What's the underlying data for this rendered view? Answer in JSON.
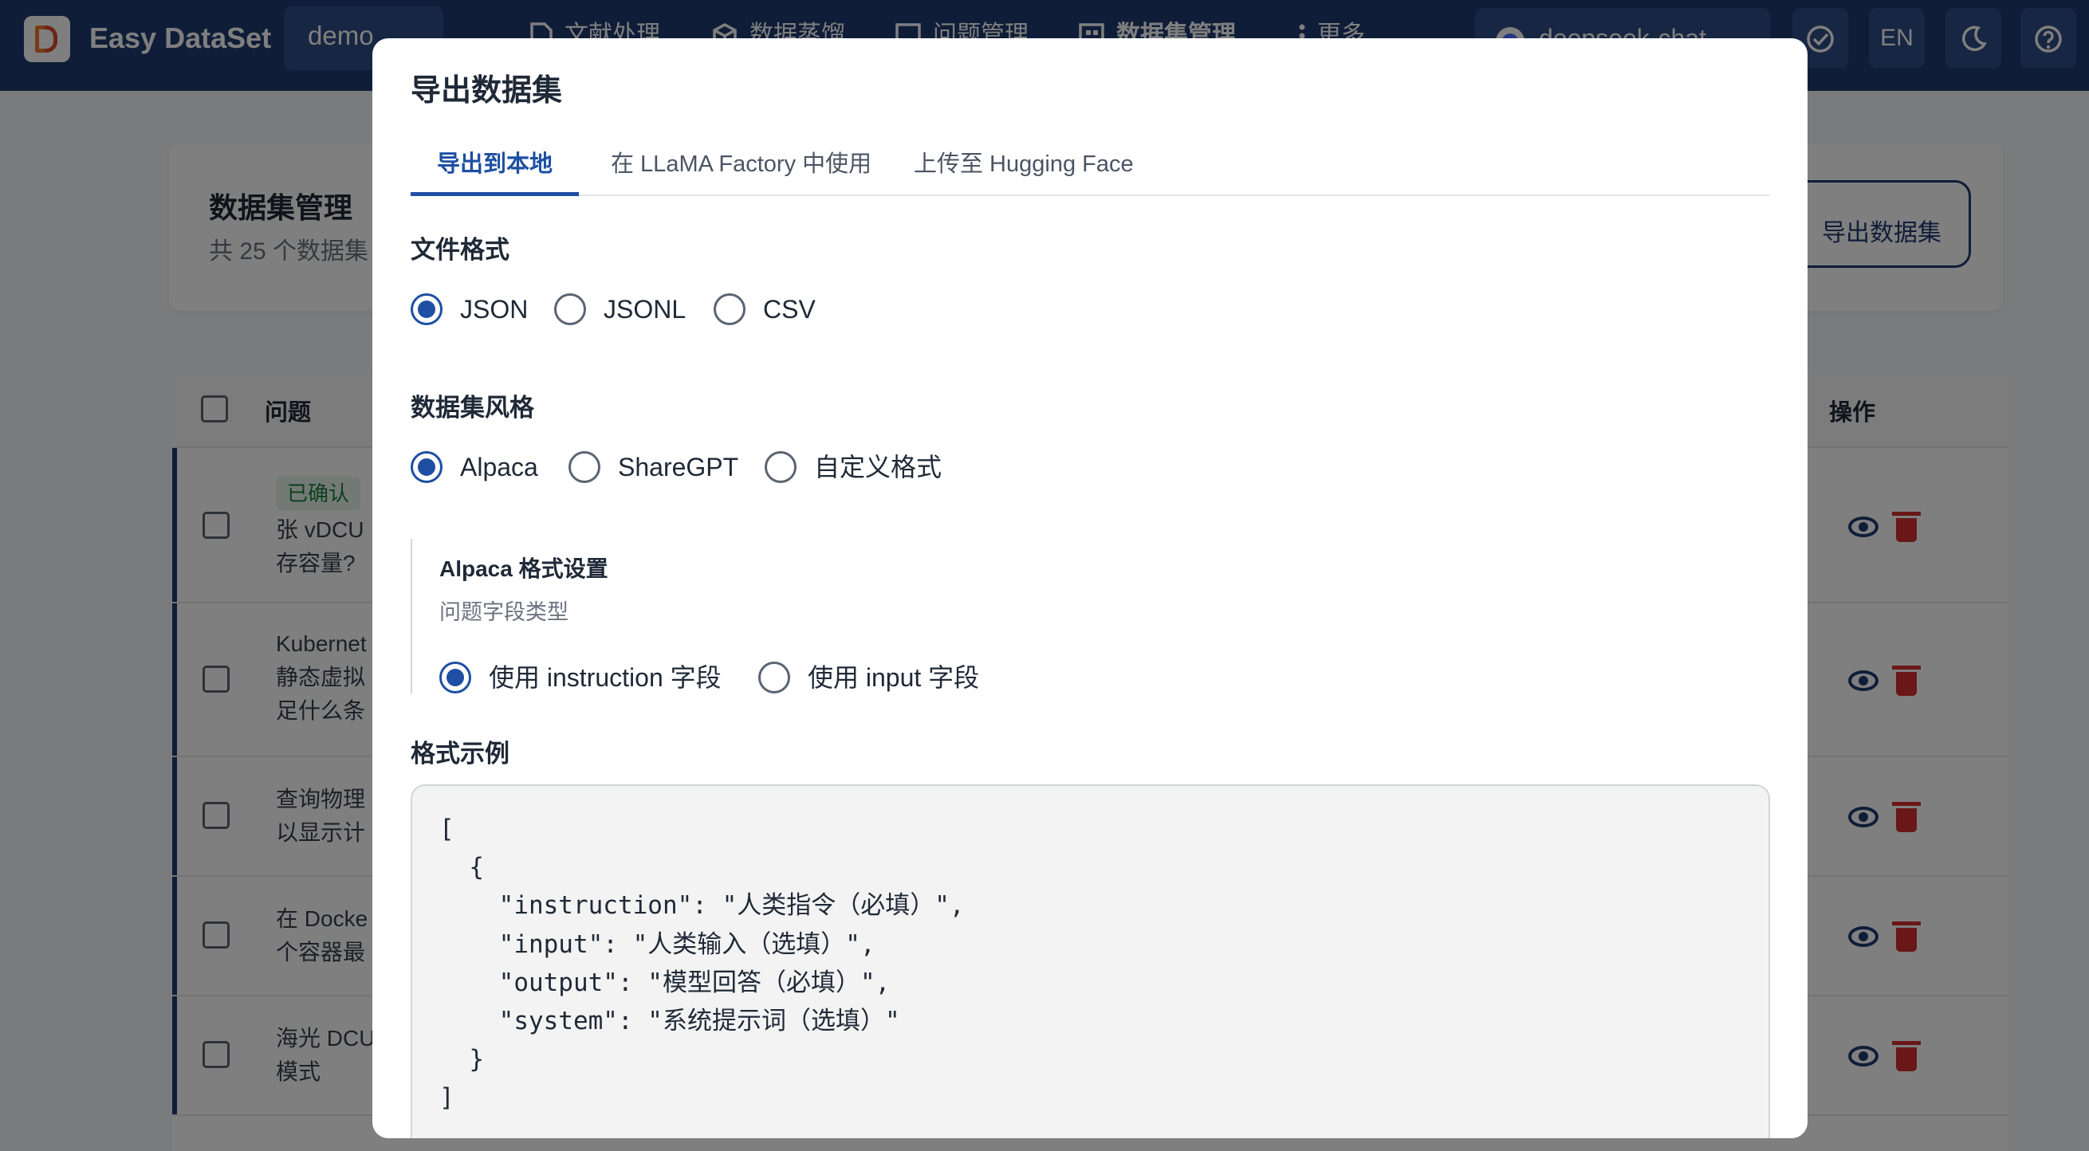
{
  "app": {
    "title": "Easy DataSet"
  },
  "project_select": {
    "value": "demo"
  },
  "nav": {
    "items": [
      {
        "label": "文献处理",
        "icon": "document-icon"
      },
      {
        "label": "数据蒸馏",
        "icon": "cube-icon"
      },
      {
        "label": "问题管理",
        "icon": "question-box-icon"
      },
      {
        "label": "数据集管理",
        "icon": "dataset-grid-icon"
      },
      {
        "label": "更多",
        "icon": "more-vertical-icon"
      }
    ]
  },
  "model_select": {
    "value": "deepseek-chat"
  },
  "header_buttons": {
    "lang": "EN"
  },
  "page": {
    "title": "数据集管理",
    "subtitle": "共 25 个数据集",
    "export_button": "导出数据集",
    "table": {
      "col_question": "问题",
      "col_actions": "操作",
      "rows": [
        {
          "status": "已确认",
          "lines": [
            "张 vDCU",
            "存容量?"
          ]
        },
        {
          "lines": [
            "Kubernet",
            "静态虚拟",
            "足什么条"
          ]
        },
        {
          "lines": [
            "查询物理",
            "以显示计"
          ]
        },
        {
          "lines": [
            "在 Docke",
            "个容器最"
          ]
        },
        {
          "lines": [
            "海光 DCU",
            "模式"
          ]
        }
      ]
    }
  },
  "dialog": {
    "title": "导出数据集",
    "tabs": [
      "导出到本地",
      "在 LLaMA Factory 中使用",
      "上传至 Hugging Face"
    ],
    "active_tab": 0,
    "file_format": {
      "label": "文件格式",
      "options": [
        "JSON",
        "JSONL",
        "CSV"
      ],
      "selected": "JSON"
    },
    "dataset_style": {
      "label": "数据集风格",
      "options": [
        "Alpaca",
        "ShareGPT",
        "自定义格式"
      ],
      "selected": "Alpaca"
    },
    "alpaca_settings": {
      "title": "Alpaca 格式设置",
      "field_caption": "问题字段类型",
      "options": [
        "使用 instruction 字段",
        "使用 input 字段"
      ],
      "selected": "使用 instruction 字段"
    },
    "example": {
      "label": "格式示例",
      "code": "[\n  {\n    \"instruction\": \"人类指令（必填）\",\n    \"input\": \"人类输入（选填）\",\n    \"output\": \"模型回答（必填）\",\n    \"system\": \"系统提示词（选填）\"\n  }\n]"
    }
  },
  "colors": {
    "nav_bg": "#1e3a70",
    "accent": "#1e4fa3",
    "confirmed_chip": "#1b7f3b",
    "danger": "#d32f2f"
  }
}
